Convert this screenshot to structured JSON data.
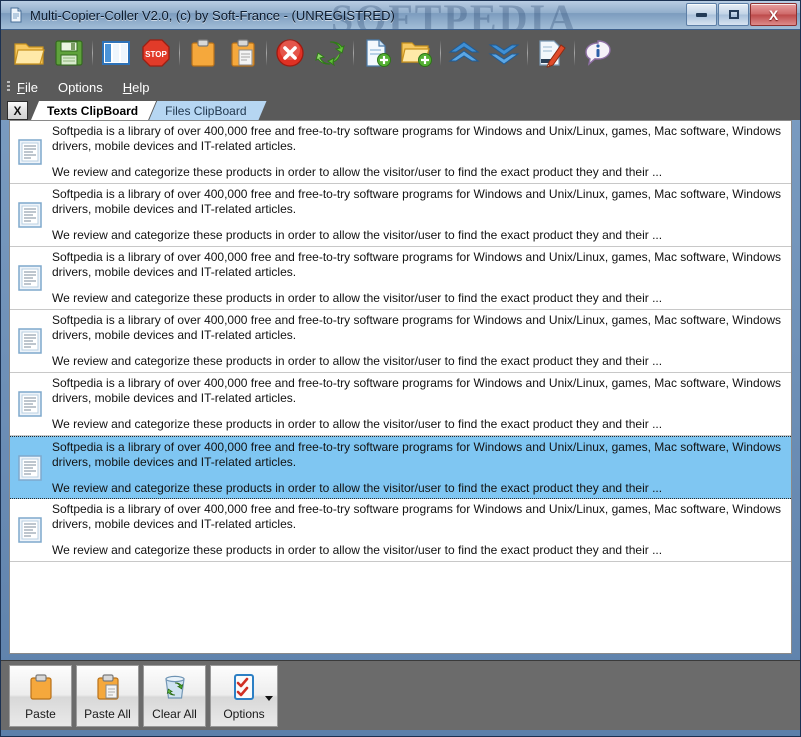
{
  "window": {
    "title": "Multi-Copier-Coller V2.0, (c) by Soft-France - (UNREGISTRED)",
    "watermark": "SOFTPEDIA",
    "icon": "document-icon",
    "controls": {
      "minimize": "minimize-button",
      "restore": "restore-button",
      "close_label": "X"
    },
    "frame_color": "#1b3152",
    "titlebar_color": "#92aecc"
  },
  "toolbar": {
    "background": "#5a5a5a",
    "buttons": [
      {
        "name": "open-folder-icon",
        "tip": "Open"
      },
      {
        "name": "save-floppy-icon",
        "tip": "Save"
      },
      {
        "sep": true
      },
      {
        "name": "columns-view-icon",
        "tip": "View"
      },
      {
        "name": "stop-sign-icon",
        "tip": "Stop"
      },
      {
        "sep": true
      },
      {
        "name": "clipboard-icon",
        "tip": "Copy to clipboard"
      },
      {
        "name": "clipboard-paste-icon",
        "tip": "Paste from clipboard"
      },
      {
        "sep": true
      },
      {
        "name": "delete-circle-icon",
        "tip": "Delete"
      },
      {
        "name": "refresh-arrows-icon",
        "tip": "Refresh"
      },
      {
        "sep": true
      },
      {
        "name": "new-document-icon",
        "tip": "New document"
      },
      {
        "name": "new-folder-icon",
        "tip": "New folder"
      },
      {
        "sep": true
      },
      {
        "name": "chevrons-up-icon",
        "tip": "Move up"
      },
      {
        "name": "chevrons-down-icon",
        "tip": "Move down"
      },
      {
        "sep": true
      },
      {
        "name": "edit-pen-icon",
        "tip": "Edit"
      },
      {
        "sep": true
      },
      {
        "name": "info-icon",
        "tip": "About"
      }
    ]
  },
  "menubar": {
    "items": [
      {
        "label": "File",
        "mnemonic": "F"
      },
      {
        "label": "Options",
        "mnemonic": ""
      },
      {
        "label": "Help",
        "mnemonic": "H"
      }
    ]
  },
  "tabs": {
    "close_label": "X",
    "items": [
      {
        "label": "Texts ClipBoard",
        "active": true
      },
      {
        "label": "Files ClipBoard",
        "active": false
      }
    ]
  },
  "list": {
    "paragraph1": "Softpedia is a library of over 400,000 free and free-to-try software programs for Windows and Unix/Linux, games, Mac software, Windows drivers, mobile devices and IT-related articles.",
    "paragraph2": "We review and categorize these products in order to allow the visitor/user to find the exact product they and their ...",
    "selected_index": 5,
    "selected_color": "#7fc6f2",
    "rows": [
      {
        "icon": "text-document-icon",
        "selected": false
      },
      {
        "icon": "text-document-icon",
        "selected": false
      },
      {
        "icon": "text-document-icon",
        "selected": false
      },
      {
        "icon": "text-document-icon",
        "selected": false
      },
      {
        "icon": "text-document-icon",
        "selected": false
      },
      {
        "icon": "text-document-icon",
        "selected": true
      },
      {
        "icon": "text-document-icon",
        "selected": false
      }
    ]
  },
  "bottombar": {
    "buttons": [
      {
        "label": "Paste",
        "icon": "clipboard-icon",
        "caret": false
      },
      {
        "label": "Paste All",
        "icon": "clipboard-paste-icon",
        "caret": false
      },
      {
        "label": "Clear All",
        "icon": "recycle-bin-icon",
        "caret": false
      },
      {
        "label": "Options",
        "icon": "checklist-icon",
        "caret": true
      }
    ]
  }
}
